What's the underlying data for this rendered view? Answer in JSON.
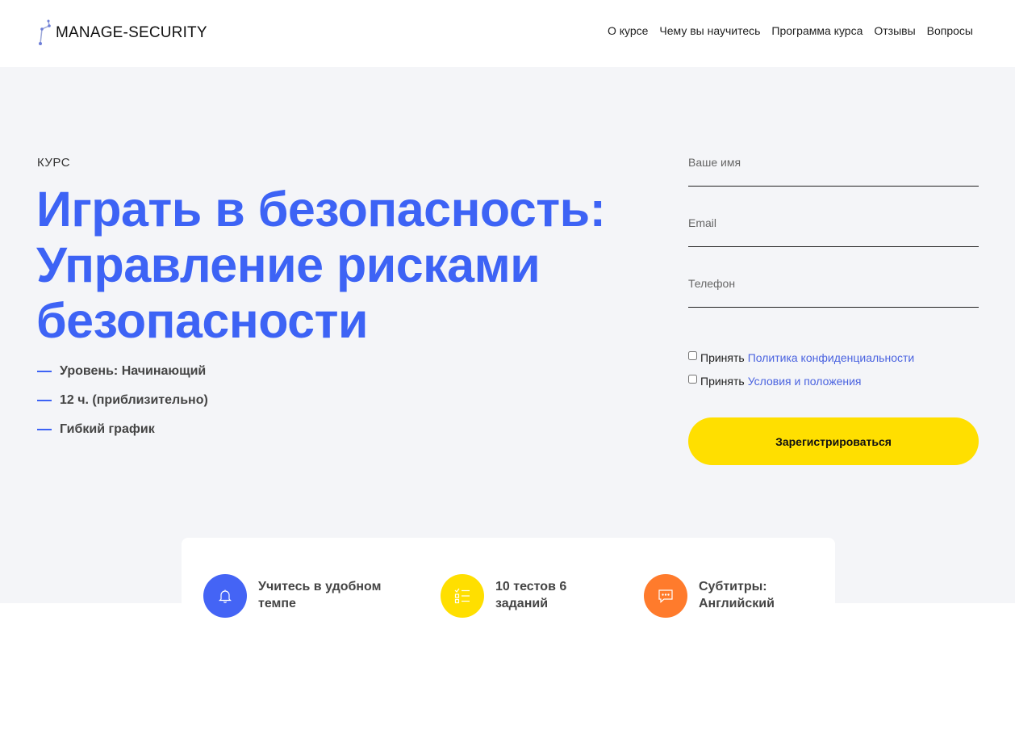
{
  "header": {
    "logo_text": "MANAGE-SECURITY",
    "nav": [
      "О курсе",
      "Чему вы научитесь",
      "Программа курса",
      "Отзывы",
      "Вопросы"
    ]
  },
  "hero": {
    "eyebrow": "КУРС",
    "title_lines": [
      "Играть в безопасность:",
      "Управление рисками",
      "безопасности"
    ],
    "features": [
      "Уровень: Начинающий",
      "12 ч. (приблизительно)",
      "Гибкий график"
    ]
  },
  "form": {
    "name_placeholder": "Ваше имя",
    "email_placeholder": "Email",
    "phone_placeholder": "Телефон",
    "privacy_prefix": "Принять",
    "privacy_link": "Политика конфиденциальности",
    "terms_prefix": "Принять",
    "terms_link": "Условия и положения",
    "submit_label": "Зарегистрироваться"
  },
  "info": [
    {
      "icon": "bell-icon",
      "color": "#4464f5",
      "text_lines": [
        "Учитесь в удобном",
        "темпе"
      ]
    },
    {
      "icon": "checklist-icon",
      "color": "#ffdf00",
      "text_lines": [
        "10 тестов 6",
        "заданий"
      ]
    },
    {
      "icon": "chat-icon",
      "color": "#ff7b2c",
      "text_lines": [
        "Субтитры:",
        "Английский"
      ]
    }
  ],
  "colors": {
    "accent_blue": "#3d63f5",
    "cta_yellow": "#ffdf00",
    "hero_bg": "#f4f5f8",
    "link": "#4a63e0"
  }
}
